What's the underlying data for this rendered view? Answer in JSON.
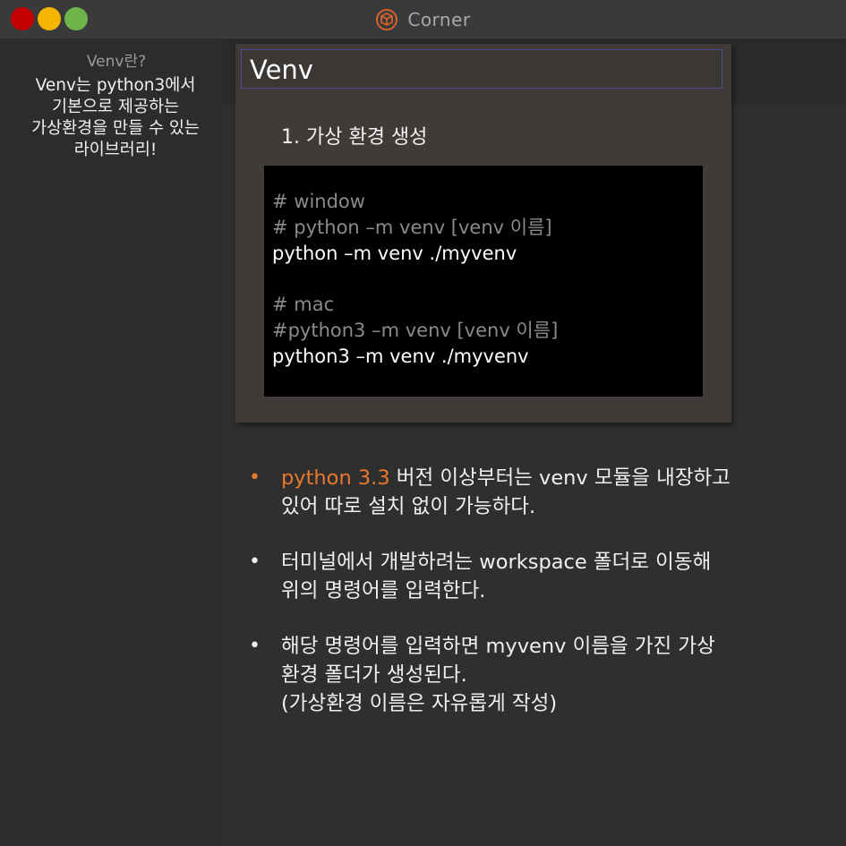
{
  "window": {
    "title": "Corner",
    "colors": {
      "close": "#c40000",
      "minimize": "#f6b500",
      "maximize": "#6fb44a",
      "title_icon": "#d9602b"
    },
    "title_icon": "box-logo-icon"
  },
  "sidebar": {
    "heading": "Venv란?",
    "description": "Venv는 python3에서\n기본으로 제공하는\n가상환경을 만들 수 있는\n라이브러리!"
  },
  "card": {
    "title": "Venv",
    "step": "1. 가상 환경 생성",
    "code_lines": [
      {
        "text": "# window",
        "kind": "comment"
      },
      {
        "text": "# python –m venv [venv 이름]",
        "kind": "comment"
      },
      {
        "text": "python –m venv ./myvenv",
        "kind": "cmd"
      },
      {
        "text": "",
        "kind": "blank"
      },
      {
        "text": "# mac",
        "kind": "comment"
      },
      {
        "text": "#python3 –m venv [venv 이름]",
        "kind": "comment"
      },
      {
        "text": "python3 –m venv ./myvenv",
        "kind": "cmd"
      }
    ]
  },
  "bullets": [
    {
      "highlight": "python 3.3",
      "line1_rest": " 버전 이상부터는 venv 모듈을 내장하고",
      "line2": "있어 따로 설치 없이 가능하다."
    },
    {
      "line1": "터미널에서 개발하려는 workspace 폴더로 이동해",
      "line2": "위의 명령어를 입력한다."
    },
    {
      "line1": "해당 명령어를 입력하면 myvenv 이름을 가진 가상",
      "line2": "환경 폴더가 생성된다.",
      "line3": "(가상환경 이름은 자유롭게 작성)"
    }
  ],
  "bullet_marker": "•",
  "accent_color": "#e8782c"
}
